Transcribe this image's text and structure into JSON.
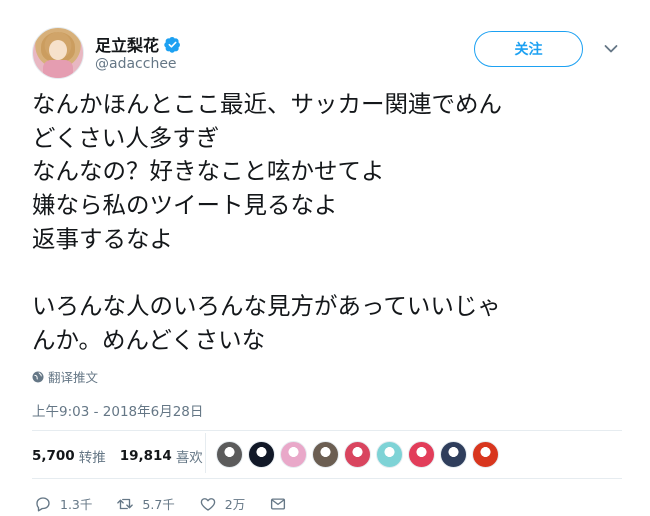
{
  "user": {
    "display_name": "足立梨花",
    "handle": "@adacchee",
    "verified_icon": "verified-badge-icon"
  },
  "follow_button": {
    "label": "关注"
  },
  "tweet": {
    "text": "なんかほんとここ最近、サッカー関連でめん\nどくさい人多すぎ\nなんなの？好きなこと呟かせてよ\n嫌なら私のツイート見るなよ\n返事するなよ\n\nいろんな人のいろんな見方があっていいじゃ\nんか。めんどくさいな",
    "translate_label": "翻译推文",
    "timestamp": "上午9:03 - 2018年6月28日"
  },
  "stats": {
    "retweets_count": "5,700",
    "retweets_label": "转推",
    "likes_count": "19,814",
    "likes_label": "喜欢"
  },
  "liker_avatars": [
    "#5b5b5b",
    "#111827",
    "#e9a8c9",
    "#6b5e52",
    "#d9455f",
    "#7ed3d6",
    "#e23d5a",
    "#2f3e5c",
    "#d8361e"
  ],
  "actions": {
    "reply_count": "1.3千",
    "retweet_count": "5.7千",
    "like_count": "2万"
  },
  "colors": {
    "accent": "#1da1f2",
    "secondary_text": "#657786",
    "divider": "#e6ecf0"
  }
}
